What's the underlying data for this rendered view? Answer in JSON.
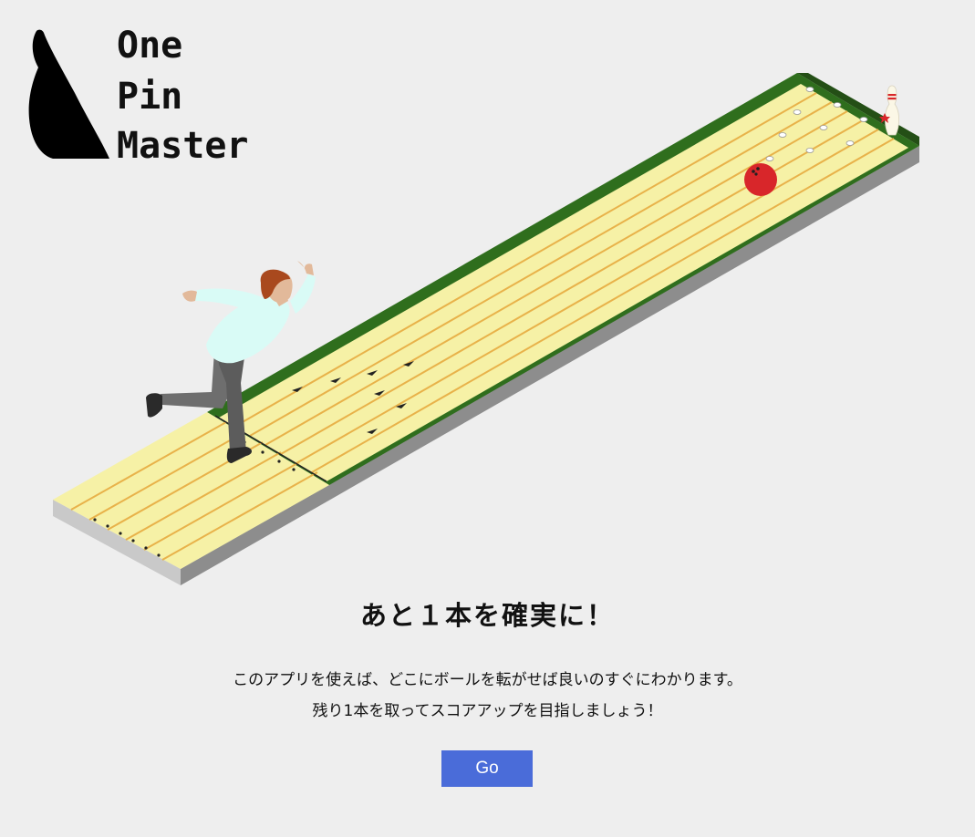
{
  "logo": {
    "line1": "One",
    "line2": "Pin",
    "line3": "Master"
  },
  "hero": {
    "title": "あと１本を確実に！",
    "description_line1": "このアプリを使えば、どこにボールを転がせば良いのすぐにわかります。",
    "description_line2": "残り1本を取ってスコアアップを目指しましょう！"
  },
  "actions": {
    "go_label": "Go"
  },
  "colors": {
    "background": "#eeeeee",
    "lane": "#f6f1a6",
    "lane_board": "#e8b24a",
    "gutter": "#2f6e1d",
    "ball": "#d8262a",
    "button": "#4a6cd9"
  }
}
